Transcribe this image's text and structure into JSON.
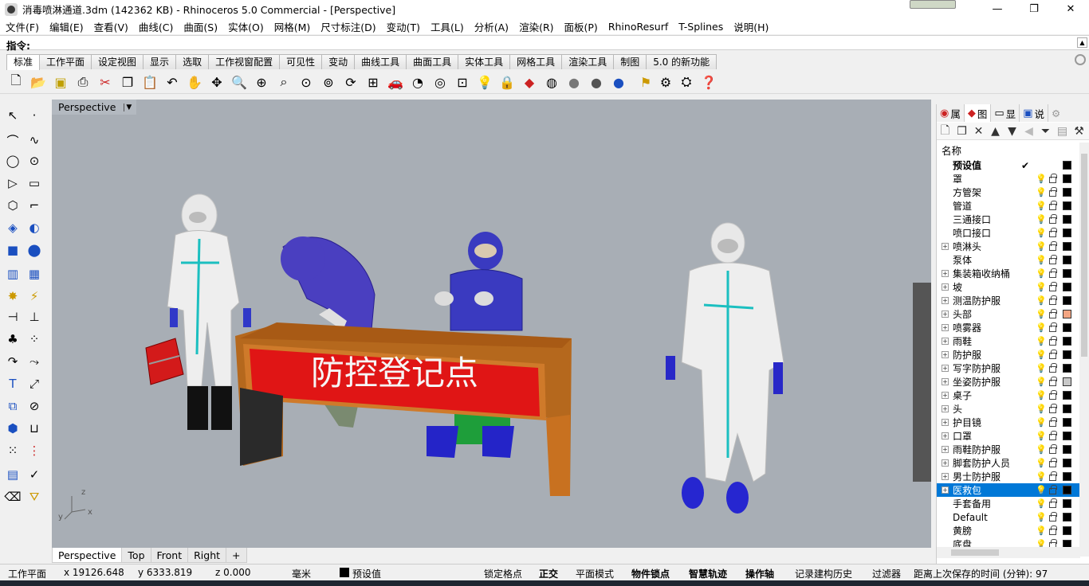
{
  "titlebar": {
    "title": "消毒喷淋通道.3dm (142362 KB) - Rhinoceros 5.0 Commercial - [Perspective]",
    "minimize": "—",
    "restore": "❐",
    "close": "✕"
  },
  "menu": [
    "文件(F)",
    "编辑(E)",
    "查看(V)",
    "曲线(C)",
    "曲面(S)",
    "实体(O)",
    "网格(M)",
    "尺寸标注(D)",
    "变动(T)",
    "工具(L)",
    "分析(A)",
    "渲染(R)",
    "面板(P)",
    "RhinoResurf",
    "T-Splines",
    "说明(H)"
  ],
  "command": {
    "label": "指令:",
    "value": ""
  },
  "toolbar_tabs": [
    "标准",
    "工作平面",
    "设定视图",
    "显示",
    "选取",
    "工作视窗配置",
    "可见性",
    "变动",
    "曲线工具",
    "曲面工具",
    "实体工具",
    "网格工具",
    "渲染工具",
    "制图",
    "5.0 的新功能"
  ],
  "toolbar_icons": [
    "new-file-icon",
    "open-icon",
    "save-icon",
    "print-icon",
    "cut-icon",
    "copy-icon",
    "paste-icon",
    "undo-icon",
    "pan-icon",
    "rotate-view-icon",
    "zoom-icon",
    "zoom-window-icon",
    "zoom-extents-icon",
    "zoom-selected-icon",
    "viewport-layout-icon",
    "car-icon",
    "shade-icon",
    "layer-icon",
    "light-icon",
    "lock-icon",
    "material-icon",
    "color-wheel-icon",
    "render-sphere-icon",
    "render-sphere2-icon",
    "render-sphere3-icon",
    "flag-icon",
    "settings-icon",
    "tools-icon",
    "help-icon"
  ],
  "viewport": {
    "label": "Perspective",
    "sign_text": "防控登记点",
    "axis_x": "x",
    "axis_y": "y",
    "axis_z": "z"
  },
  "viewport_tabs": [
    "Perspective",
    "Top",
    "Front",
    "Right",
    "+"
  ],
  "panel": {
    "tabs": [
      "属",
      "图",
      "显",
      "说"
    ],
    "name_header": "名称",
    "layers": [
      {
        "name": "预设值",
        "check": "✔",
        "color": "#000000",
        "expand": false,
        "bold": true
      },
      {
        "name": "罩",
        "color": "#000000",
        "expand": false
      },
      {
        "name": "方管架",
        "color": "#000000",
        "expand": false
      },
      {
        "name": "管道",
        "color": "#000000",
        "expand": false
      },
      {
        "name": "三通接口",
        "color": "#000000",
        "expand": false
      },
      {
        "name": "喷口接口",
        "color": "#000000",
        "expand": false
      },
      {
        "name": "喷淋头",
        "color": "#000000",
        "expand": true
      },
      {
        "name": "泵体",
        "color": "#000000",
        "expand": false
      },
      {
        "name": "集装箱收纳桶",
        "color": "#000000",
        "expand": true
      },
      {
        "name": "坡",
        "color": "#000000",
        "expand": true
      },
      {
        "name": "测温防护服",
        "color": "#000000",
        "expand": true
      },
      {
        "name": "头部",
        "color": "#f4a582",
        "expand": true
      },
      {
        "name": "喷雾器",
        "color": "#000000",
        "expand": true
      },
      {
        "name": "雨鞋",
        "color": "#000000",
        "expand": true
      },
      {
        "name": "防护服",
        "color": "#000000",
        "expand": true
      },
      {
        "name": "写字防护服",
        "color": "#000000",
        "expand": true
      },
      {
        "name": "坐姿防护服",
        "color": "#c8c8c8",
        "expand": true
      },
      {
        "name": "桌子",
        "color": "#000000",
        "expand": true
      },
      {
        "name": "头",
        "color": "#000000",
        "expand": true
      },
      {
        "name": "护目镜",
        "color": "#000000",
        "expand": true
      },
      {
        "name": "口罩",
        "color": "#000000",
        "expand": true
      },
      {
        "name": "雨鞋防护服",
        "color": "#000000",
        "expand": true
      },
      {
        "name": "脚套防护人员",
        "color": "#000000",
        "expand": true
      },
      {
        "name": "男士防护服",
        "color": "#000000",
        "expand": true
      },
      {
        "name": "医救包",
        "color": "#000000",
        "expand": true,
        "selected": true
      },
      {
        "name": "手套备用",
        "color": "#000000",
        "expand": false,
        "blue_bulb": true
      },
      {
        "name": "Default",
        "color": "#000000",
        "expand": false
      },
      {
        "name": "黄膀",
        "color": "#000000",
        "expand": false
      },
      {
        "name": "底盘",
        "color": "#000000",
        "expand": false
      }
    ]
  },
  "status": {
    "cplane": "工作平面",
    "x": "x 19126.648",
    "y": "y 6333.819",
    "z": "z 0.000",
    "units": "毫米",
    "layer": "预设值",
    "grid_snap": "锁定格点",
    "ortho": "正交",
    "planar": "平面模式",
    "osnap": "物件锁点",
    "smarttrack": "智慧轨迹",
    "gumball": "操作轴",
    "history": "记录建构历史",
    "filter": "过滤器",
    "autosave": "距离上次保存的时间 (分钟): 97"
  }
}
